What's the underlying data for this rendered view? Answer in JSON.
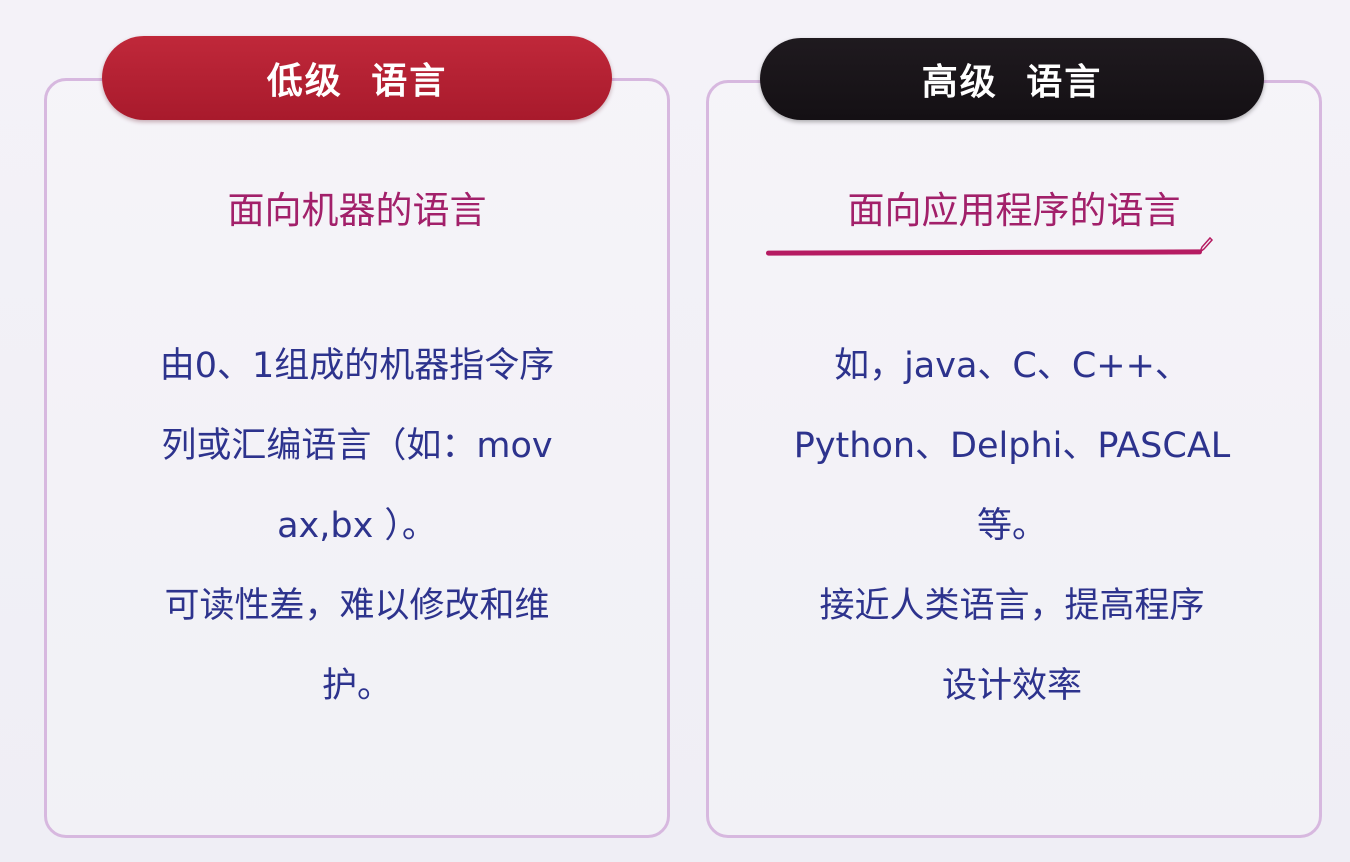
{
  "low_level": {
    "header": "低级 语言",
    "subtitle": "面向机器的语言",
    "lines": [
      "由0、1组成的机器指令序",
      "列或汇编语言（如：mov",
      "ax,bx ）。",
      "可读性差，难以修改和维",
      "护。"
    ],
    "colors": {
      "header_bg": "#b01f32",
      "subtitle": "#a2206a",
      "body": "#2d338d"
    }
  },
  "high_level": {
    "header": "高级 语言",
    "subtitle": "面向应用程序的语言",
    "lines": [
      "如，java、C、C++、",
      "Python、Delphi、PASCAL",
      "等。",
      "接近人类语言，提高程序",
      "设计效率"
    ],
    "colors": {
      "header_bg": "#171217",
      "subtitle": "#a2206a",
      "underline": "#b51b62",
      "body": "#2d338d"
    },
    "icons": [
      "pen-icon"
    ]
  }
}
